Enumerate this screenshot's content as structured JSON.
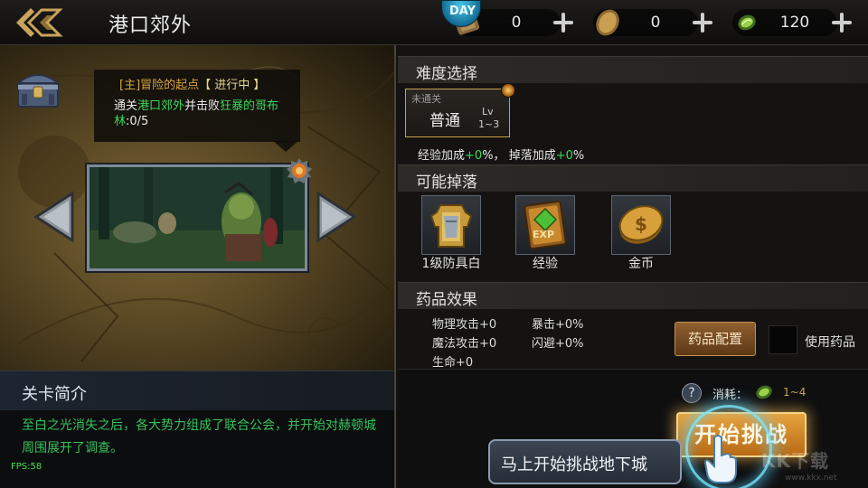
{
  "header": {
    "title": "港口郊外",
    "logo_text": "DAY",
    "resources": [
      {
        "name": "ticket",
        "value": "0",
        "icon": "ticket-icon"
      },
      {
        "name": "bronze-coin",
        "value": "0",
        "icon": "bronze-coin-icon"
      },
      {
        "name": "green-gem",
        "value": "120",
        "icon": "green-gem-icon"
      }
    ]
  },
  "quest": {
    "tag": "[主]",
    "name": "冒险的起点",
    "status": "【 进行中 】",
    "desc_prefix": "通关",
    "desc_place": "港口郊外",
    "desc_mid": "并击败",
    "desc_target": "狂暴的哥布林",
    "desc_progress": ":0/5"
  },
  "intro": {
    "header": "关卡简介",
    "text": "至白之光消失之后，各大势力组成了联合公会，并开始对赫顿城周围展开了调查。",
    "fps": "FPS:58"
  },
  "difficulty": {
    "header": "难度选择",
    "card_status": "未通关",
    "card_name": "普通",
    "card_lv": "Lv",
    "card_range": "1~3",
    "exp_label": "经验加成",
    "exp_value": "+0",
    "exp_suffix": "%，",
    "drop_label": "掉落加成",
    "drop_value": "+0",
    "drop_suffix": "%"
  },
  "drops": {
    "header": "可能掉落",
    "items": [
      {
        "label": "1级防具白",
        "icon": "armor-icon"
      },
      {
        "label": "经验",
        "icon": "exp-book-icon"
      },
      {
        "label": "金币",
        "icon": "gold-coin-icon"
      }
    ]
  },
  "potions": {
    "header": "药品效果",
    "stats": [
      {
        "label": "物理攻击",
        "value": "+0"
      },
      {
        "label": "暴击",
        "value": "+0%"
      },
      {
        "label": "魔法攻击",
        "value": "+0"
      },
      {
        "label": "闪避",
        "value": "+0%"
      },
      {
        "label": "生命",
        "value": "+0"
      }
    ],
    "config_button": "药品配置",
    "use_label": "使用药品"
  },
  "challenge": {
    "cost_label": "消耗：",
    "cost_value": "1~4",
    "start_button": "开始挑战",
    "tip": "马上开始挑战地下城"
  },
  "watermark": {
    "text": "KK下载",
    "sub": "www.kkx.net"
  },
  "colors": {
    "highlight_green": "#39d85c",
    "quest_gold": "#d7a640",
    "button_orange": "#e7a43f"
  }
}
